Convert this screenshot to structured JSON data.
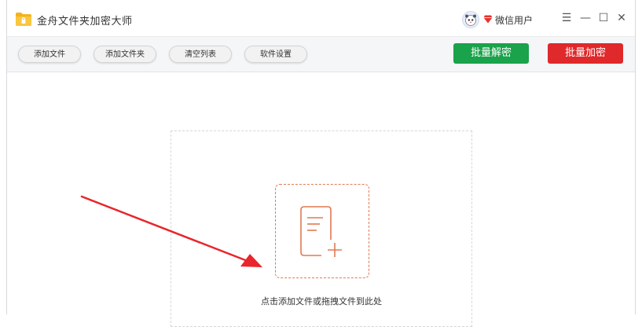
{
  "app": {
    "title": "金舟文件夹加密大师",
    "user_name": "微信用户"
  },
  "window_controls": {
    "menu": "☰",
    "minimize": "—",
    "maximize": "☐",
    "close": "✕"
  },
  "toolbar": {
    "add_file": "添加文件",
    "add_folder": "添加文件夹",
    "clear_list": "清空列表",
    "settings": "软件设置",
    "batch_decrypt": "批量解密",
    "batch_encrypt": "批量加密"
  },
  "drop_zone": {
    "hint": "点击添加文件或拖拽文件到此处",
    "icon": "file-add-icon"
  },
  "colors": {
    "decrypt_green": "#1aa34a",
    "encrypt_red": "#e0292b",
    "accent_orange": "#e07a52",
    "arrow_red": "#e8262b"
  }
}
